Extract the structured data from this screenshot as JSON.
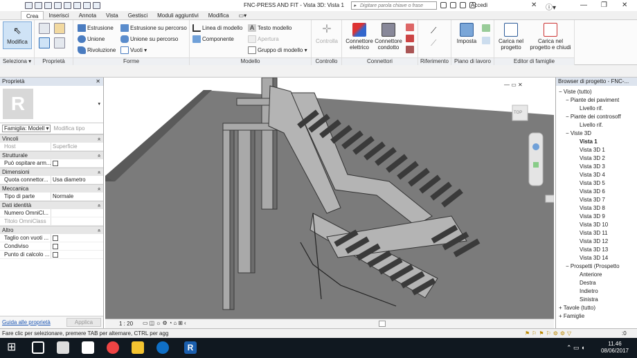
{
  "window": {
    "title": "FNC-PRESS AND FIT - Vista 3D: Vista 1",
    "search_placeholder": "Digitare parola chiave o frase",
    "account": "Accedi"
  },
  "tabs": [
    "Crea",
    "Inserisci",
    "Annota",
    "Vista",
    "Gestisci",
    "Moduli aggiuntivi",
    "Modifica"
  ],
  "ribbon": {
    "modifica": "Modifica",
    "seleziona": "Seleziona ▾",
    "proprieta": "Proprietà",
    "forme": {
      "label": "Forme",
      "estrusione": "Estrusione",
      "unione": "Unione",
      "rivoluzione": "Rivoluzione",
      "estr_perc": "Estrusione su percorso",
      "unione_perc": "Unione su percorso",
      "vuoti": "Vuoti ▾"
    },
    "modello": {
      "label": "Modello",
      "linea": "Linea di modello",
      "componente": "Componente",
      "testo": "Testo modello",
      "apertura": "Apertura",
      "gruppo": "Gruppo di modello ▾"
    },
    "controllo": {
      "label": "Controllo",
      "btn": "Controlla"
    },
    "connettori": {
      "label": "Connettori",
      "elettrico": "Connettore elettrico",
      "condotto": "Connettore condotto"
    },
    "riferimento": {
      "label": "Riferimento"
    },
    "piano": {
      "label": "Piano di lavoro",
      "imposta": "Imposta"
    },
    "editor": {
      "label": "Editor di famiglie",
      "carica": "Carica nel progetto",
      "carica_chiudi": "Carica nel progetto e chiudi"
    }
  },
  "properties": {
    "title": "Proprietà",
    "family": "Famiglia: Modell ▾",
    "edit_type": "Modifica tipo",
    "help": "Guida alle proprietà",
    "apply": "Applica",
    "sections": [
      {
        "name": "Vincoli",
        "rows": [
          {
            "k": "Host",
            "v": "Superficie",
            "dim": true
          }
        ]
      },
      {
        "name": "Strutturale",
        "rows": [
          {
            "k": "Può ospitare arm...",
            "cb": true
          }
        ]
      },
      {
        "name": "Dimensioni",
        "rows": [
          {
            "k": "Quota connettor...",
            "v": "Usa diametro"
          }
        ]
      },
      {
        "name": "Meccanica",
        "rows": [
          {
            "k": "Tipo di parte",
            "v": "Normale"
          }
        ]
      },
      {
        "name": "Dati identità",
        "rows": [
          {
            "k": "Numero OmniCl...",
            "v": ""
          },
          {
            "k": "Titolo OmniClass",
            "v": "",
            "dim": true
          }
        ]
      },
      {
        "name": "Altro",
        "rows": [
          {
            "k": "Taglio con vuoti ...",
            "cb": true
          },
          {
            "k": "Condiviso",
            "cb": true
          },
          {
            "k": "Punto di calcolo ...",
            "cb": true
          }
        ]
      }
    ]
  },
  "view": {
    "scale": "1 : 20",
    "viewcube": "TOP"
  },
  "browser": {
    "title": "Browser di progetto - FNC-...",
    "items": [
      {
        "t": "Viste (tutto)",
        "lvl": 0,
        "pm": "−"
      },
      {
        "t": "Piante dei paviment",
        "lvl": 1,
        "pm": "−"
      },
      {
        "t": "Livello rif.",
        "lvl": 3
      },
      {
        "t": "Piante dei controsoff",
        "lvl": 1,
        "pm": "−"
      },
      {
        "t": "Livello rif.",
        "lvl": 3
      },
      {
        "t": "Viste 3D",
        "lvl": 1,
        "pm": "−"
      },
      {
        "t": "Vista 1",
        "lvl": 3,
        "bold": true
      },
      {
        "t": "Vista 3D 1",
        "lvl": 3
      },
      {
        "t": "Vista 3D 2",
        "lvl": 3
      },
      {
        "t": "Vista 3D 3",
        "lvl": 3
      },
      {
        "t": "Vista 3D 4",
        "lvl": 3
      },
      {
        "t": "Vista 3D 5",
        "lvl": 3
      },
      {
        "t": "Vista 3D 6",
        "lvl": 3
      },
      {
        "t": "Vista 3D 7",
        "lvl": 3
      },
      {
        "t": "Vista 3D 8",
        "lvl": 3
      },
      {
        "t": "Vista 3D 9",
        "lvl": 3
      },
      {
        "t": "Vista 3D 10",
        "lvl": 3
      },
      {
        "t": "Vista 3D 11",
        "lvl": 3
      },
      {
        "t": "Vista 3D 12",
        "lvl": 3
      },
      {
        "t": "Vista 3D 13",
        "lvl": 3
      },
      {
        "t": "Vista 3D 14",
        "lvl": 3
      },
      {
        "t": "Prospetti (Prospetto",
        "lvl": 1,
        "pm": "−"
      },
      {
        "t": "Anteriore",
        "lvl": 3
      },
      {
        "t": "Destra",
        "lvl": 3
      },
      {
        "t": "Indietro",
        "lvl": 3
      },
      {
        "t": "Sinistra",
        "lvl": 3
      },
      {
        "t": "Tavole (tutto)",
        "lvl": 0,
        "pm": "+"
      },
      {
        "t": "Famiglie",
        "lvl": 0,
        "pm": "+"
      }
    ]
  },
  "status": {
    "text": "Fare clic per selezionare, premere TAB per alternare, CTRL per agg",
    "zero": ":0"
  },
  "clock": {
    "time": "11.46",
    "date": "08/06/2017"
  }
}
